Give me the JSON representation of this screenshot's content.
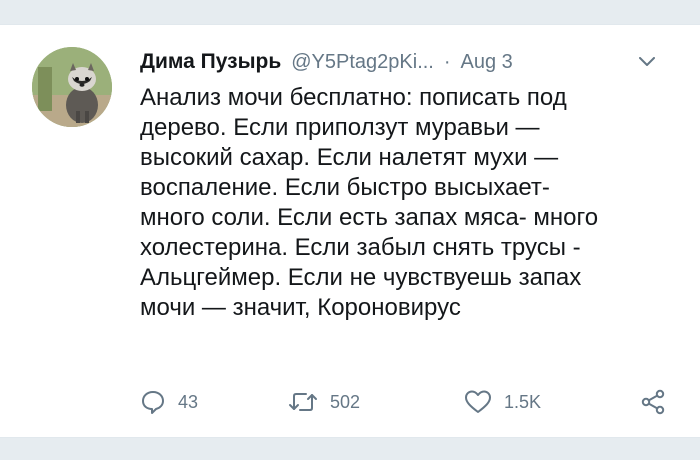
{
  "tweet": {
    "author": {
      "display_name": "Дима Пузырь",
      "handle": "@Y5Ptag2pKi...",
      "avatar_icon": "raccoon-avatar"
    },
    "separator": "·",
    "date": "Aug 3",
    "text_lines": [
      "Анализ мочи бесплатно: пописать под",
      "дерево. Если приползут муравьи —",
      "высокий сахар. Если налетят мухи —",
      "воспаление. Если быстро высыхает-",
      "много соли. Если есть запах мяса- много",
      "холестерина. Если забыл снять трусы -",
      "Альцгеймер. Если не чувствуешь запах",
      "мочи — значит, Короновирус"
    ],
    "actions": {
      "reply": {
        "icon": "reply-icon",
        "count": "43"
      },
      "retweet": {
        "icon": "retweet-icon",
        "count": "502"
      },
      "like": {
        "icon": "heart-icon",
        "count": "1.5K"
      },
      "share": {
        "icon": "share-icon"
      }
    },
    "menu_icon": "chevron-down-icon"
  },
  "colors": {
    "background": "#e6ecf0",
    "card": "#ffffff",
    "text": "#14171a",
    "secondary": "#657786"
  }
}
